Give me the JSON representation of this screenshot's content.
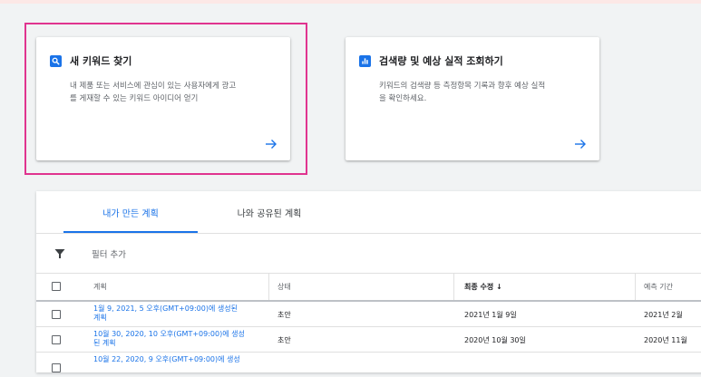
{
  "cards": [
    {
      "title": "새 키워드 찾기",
      "desc_line1": "내 제품 또는 서비스에 관심이 있는 사용자에게 광고",
      "desc_line2": "를 게재할 수 있는 키워드 아이디어 얻기",
      "icon": "search-icon"
    },
    {
      "title": "검색량 및 예상 실적 조회하기",
      "desc_line1": "키워드의 검색량 등 측정항목 기록과 향후 예상 실적",
      "desc_line2": "을 확인하세요.",
      "icon": "bar-chart-icon"
    }
  ],
  "tabs": [
    {
      "label": "내가 만든 계획"
    },
    {
      "label": "나와 공유된 계획"
    }
  ],
  "filter": {
    "label": "필터 추가",
    "icon": "filter-icon"
  },
  "table": {
    "columns": [
      "계획",
      "상태",
      "최종 수정 ↓",
      "예측 기간"
    ],
    "rows": [
      {
        "plan_line1": "1월 9, 2021, 5 오후(GMT+09:00)에 생성된",
        "plan_line2": "계획",
        "status": "초안",
        "modified": "2021년 1월 9일",
        "period": "2021년 2월"
      },
      {
        "plan_line1": "10월 30, 2020, 10 오후(GMT+09:00)에 생성",
        "plan_line2": "된 계획",
        "status": "초안",
        "modified": "2020년 10월 30일",
        "period": "2020년 11월"
      },
      {
        "plan_line1": "10월 22, 2020, 9 오후(GMT+09:00)에 생성",
        "plan_line2": "",
        "status": "",
        "modified": "",
        "period": ""
      }
    ]
  },
  "colors": {
    "accent": "#1a73e8",
    "highlight": "#e0348f",
    "background": "#f1f3f4"
  }
}
